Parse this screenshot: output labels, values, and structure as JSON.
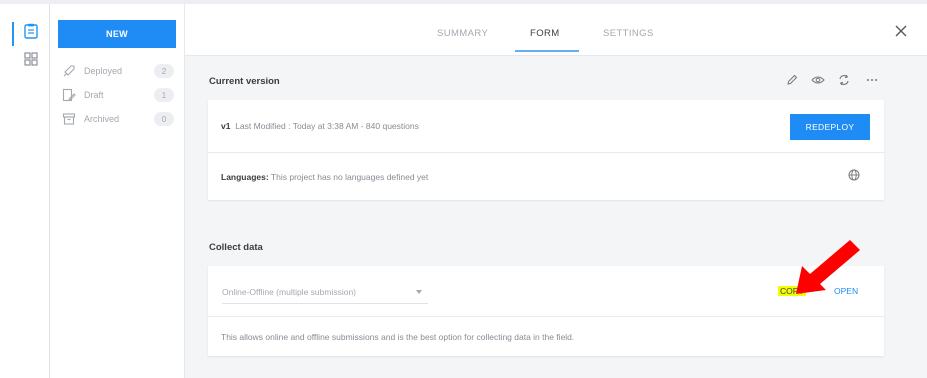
{
  "sidebar": {
    "new_label": "NEW",
    "items": [
      {
        "label": "Deployed",
        "count": "2",
        "icon": "rocket-icon"
      },
      {
        "label": "Draft",
        "count": "1",
        "icon": "draft-icon"
      },
      {
        "label": "Archived",
        "count": "0",
        "icon": "archive-icon"
      }
    ]
  },
  "tabs": [
    {
      "label": "SUMMARY"
    },
    {
      "label": "FORM"
    },
    {
      "label": "SETTINGS"
    }
  ],
  "current_version": {
    "title": "Current version",
    "version": "v1",
    "modified_text": "Last Modified : Today at 3:38 AM - 840 questions",
    "redeploy_label": "REDEPLOY",
    "languages_label": "Languages:",
    "languages_text": "This project has no languages defined yet"
  },
  "collect_data": {
    "title": "Collect data",
    "select_value": "Online-Offline (multiple submission)",
    "copy_label": "COPY",
    "open_label": "OPEN",
    "description": "This allows online and offline submissions and is the best option for collecting data in the field."
  },
  "colors": {
    "accent": "#1f8cf5",
    "highlight": "#f2ff00",
    "arrow": "#ff0000"
  }
}
